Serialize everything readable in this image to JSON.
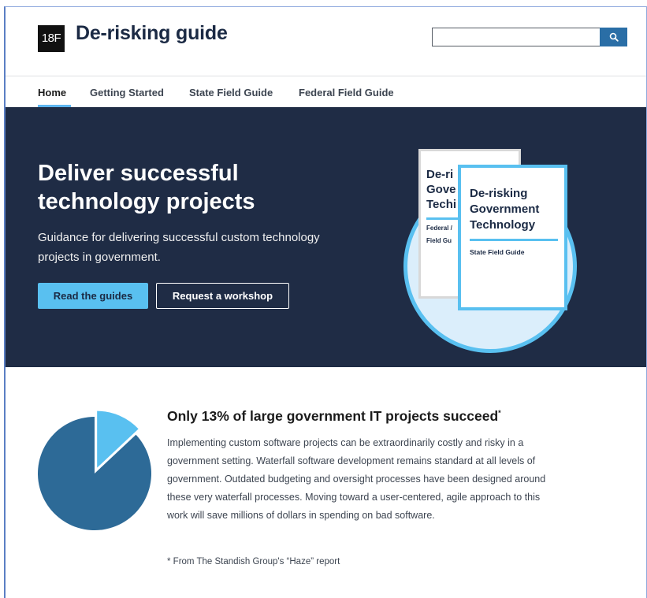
{
  "header": {
    "logo": "18F",
    "title": "De-risking guide",
    "search": {
      "placeholder": "",
      "button_icon": "search-icon"
    }
  },
  "nav": {
    "items": [
      "Home",
      "Getting Started",
      "State Field Guide",
      "Federal Field Guide"
    ],
    "active": "Home"
  },
  "hero": {
    "title": "Deliver successful technology projects",
    "subtitle": "Guidance for delivering successful custom technology projects in government.",
    "primary_button": "Read the guides",
    "secondary_button": "Request a workshop",
    "books": {
      "back": {
        "title_lines": [
          "De-ri",
          "Gove",
          "Techi"
        ],
        "subtitle_lines": [
          "Federal /",
          "Field Gu"
        ]
      },
      "front": {
        "title_lines": [
          "De-risking",
          "Government",
          "Technology"
        ],
        "subtitle": "State Field Guide"
      }
    }
  },
  "stat": {
    "title": "Only 13% of large government IT projects succeed",
    "title_marker": "*",
    "body": "Implementing custom software projects can be extraordinarily costly and risky in a government setting. Waterfall software development remains standard at all levels of government. Outdated budgeting and oversight processes have been designed around these very waterfall processes. Moving toward a user-centered, agile approach to this work will save millions of dollars in spending on bad software.",
    "footnote": "* From The Standish Group's “Haze” report",
    "pie": {
      "success_fraction": 0.13,
      "colors": {
        "main": "#2d6a97",
        "slice": "#59c0f0"
      }
    }
  },
  "colors": {
    "hero_bg": "#1f2c45",
    "accent": "#59c0f0",
    "search_button": "#2a6ea6"
  }
}
